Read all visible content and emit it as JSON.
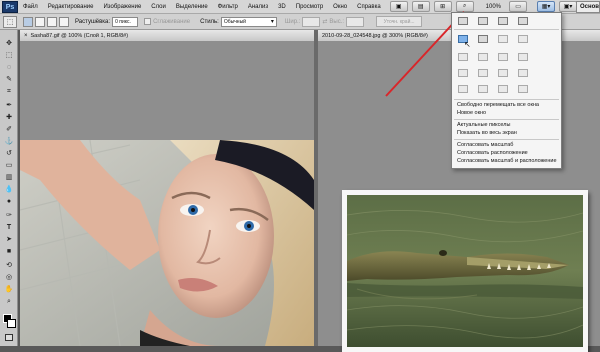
{
  "menubar": {
    "logo": "Ps",
    "items": [
      "Файл",
      "Редактирование",
      "Изображение",
      "Слои",
      "Выделение",
      "Фильтр",
      "Анализ",
      "3D",
      "Просмотр",
      "Окно",
      "Справка"
    ],
    "zoom": "100%",
    "workspace_label": "Основ"
  },
  "options": {
    "feather_label": "Растушёвка:",
    "feather_value": "0 пикс.",
    "antialias_label": "Сглаживание",
    "style_label": "Стиль:",
    "style_value": "Обычный",
    "width_label": "Шир.:",
    "height_label": "Выс.:",
    "refine_button": "Уточн. край..."
  },
  "documents": [
    {
      "title": "Sasha87.gif @ 100% (Слой 1, RGB/8#)",
      "close": "×"
    },
    {
      "title": "2010-09-28_024548.jpg @ 300% (RGB/8#)",
      "close": ""
    }
  ],
  "arrange_menu": {
    "items": [
      "Свободно перемещать все окна",
      "Новое окно",
      "Актуальные пикселы",
      "Показать во весь экран",
      "Согласовать масштаб",
      "Согласовать расположение",
      "Согласовать масштаб и расположение"
    ]
  },
  "colors": {
    "arrow": "#d9262a",
    "accent": "#3a6ea5"
  }
}
